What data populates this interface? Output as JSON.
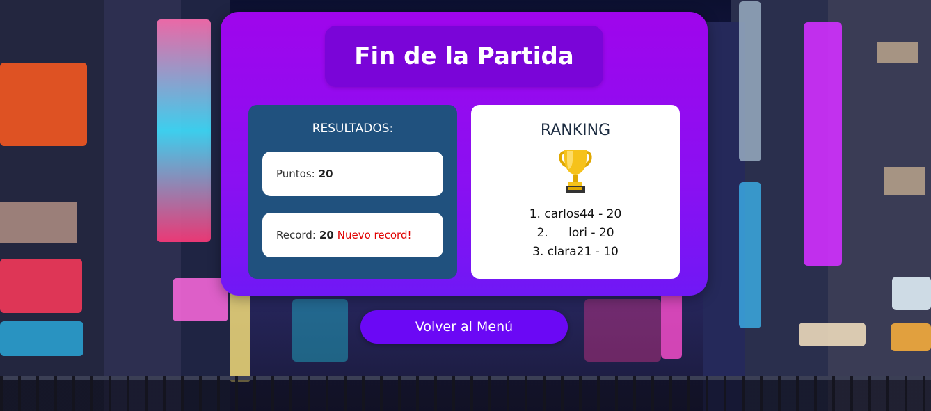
{
  "title": "Fin de la Partida",
  "results": {
    "heading": "RESULTADOS:",
    "points_label": "Puntos:",
    "points_value": "20",
    "record_label": "Record:",
    "record_value": "20",
    "record_note": "Nuevo record!"
  },
  "ranking": {
    "heading": "RANKING",
    "icon": "trophy-icon",
    "entries": [
      {
        "position": "1.",
        "text": "carlos44 - 20"
      },
      {
        "position": "2.",
        "text": "lori - 20"
      },
      {
        "position": "3.",
        "text": "clara21 - 10"
      }
    ]
  },
  "menu_button_label": "Volver al Menú",
  "colors": {
    "card": "#9f05ec",
    "title_box": "#7a05d8",
    "results_panel": "#20517e",
    "button": "#6b08f5",
    "new_record": "#e00000"
  }
}
